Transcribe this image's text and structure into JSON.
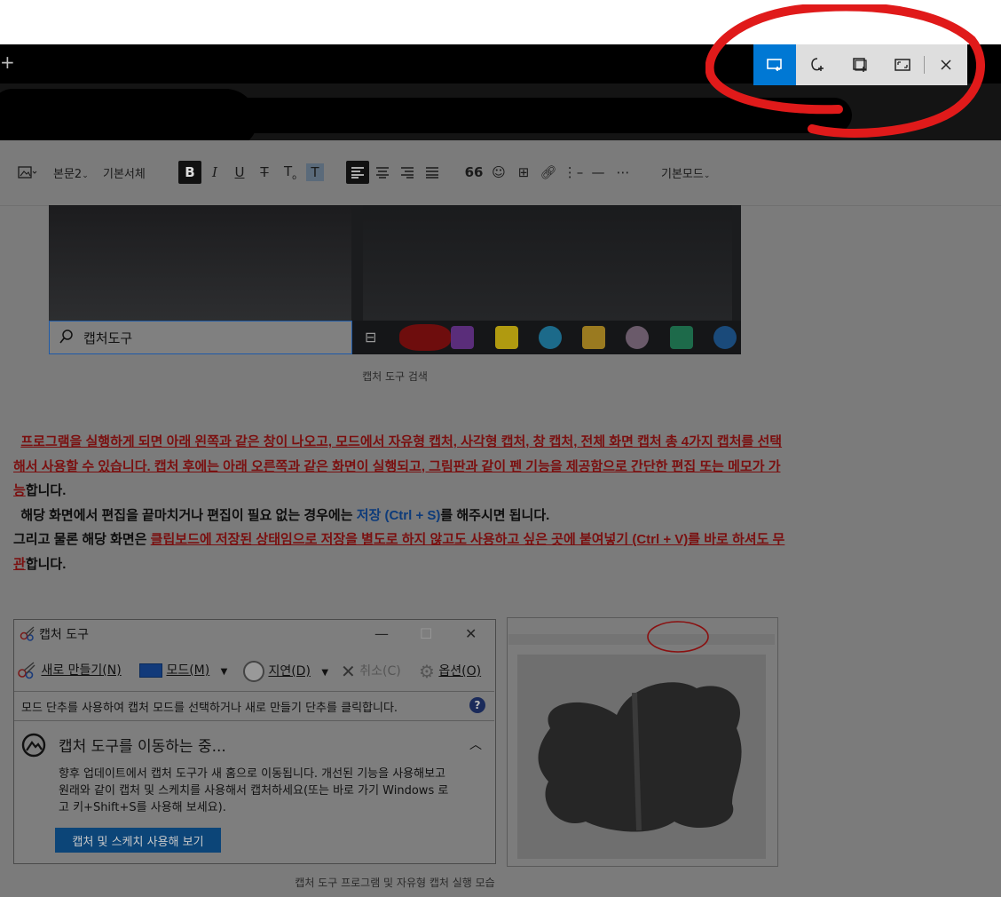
{
  "snip_toolbar": {
    "buttons": [
      {
        "name": "rectangular-snip-icon",
        "active": true
      },
      {
        "name": "freeform-snip-icon",
        "active": false
      },
      {
        "name": "window-snip-icon",
        "active": false
      },
      {
        "name": "fullscreen-snip-icon",
        "active": false
      }
    ],
    "close_icon": "close-icon",
    "accent": "#0078d4",
    "annotation_color": "#e01a1a"
  },
  "tabbar": {
    "add_label": "+"
  },
  "editor_toolbar": {
    "image_label": "",
    "paragraph_style": "본문2",
    "font": "기본서체",
    "mode": "기본모드"
  },
  "figure1": {
    "search_text": "캡처도구",
    "caption": "캡처 도구 검색"
  },
  "paragraph": {
    "line1_hl": "프로그램을 실행하게 되면 아래 왼쪽과 같은 창이 나오고, 모드에서 자유형 캡처, 사각형 캡처, 창 캡처, 전체 화면 캡처 총 4가지 캡처를 선택해서 사용할 수 있습니다. 캡처 후에는 아래 오른쪽과 같은 화면이 실행되고, 그림판과 같이 펜 기능을 제공함으로 간단한 편집 또는 메모가 가능",
    "line1_tail": "합니다.",
    "line2_pre": "해당 화면에서 편집을 끝마치거나 편집이 필요 없는 경우에는 ",
    "line2_blue": "저장 (Ctrl + S)",
    "line2_tail": "를 해주시면 됩니다.",
    "line3_pre": "그리고 물론 해당 화면은 ",
    "line3_hl": "클립보드에 저장된 상태임으로 저장을 별도로 하지 않고도 사용하고 싶은 곳에 붙여넣기 (Ctrl + V)를 바로 하셔도 무관",
    "line3_tail": "합니다."
  },
  "snipping_tool": {
    "title": "캡처 도구",
    "new_label": "새로 만들기(N)",
    "mode_label": "모드(M)",
    "delay_label": "지연(D)",
    "cancel_label": "취소(C)",
    "options_label": "옵션(O)",
    "hint": "모드 단추를 사용하여 캡처 모드를 선택하거나 새로 만들기 단추를 클릭합니다.",
    "moving_title": "캡처 도구를 이동하는 중...",
    "moving_body": "향후 업데이트에서 캡처 도구가 새 홈으로 이동됩니다. 개선된 기능을 사용해보고 원래와 같이 캡처 및 스케치를 사용해서 캡처하세요(또는 바로 가기 Windows 로고 키+Shift+S를 사용해 보세요).",
    "sketch_button": "캡처 및 스케치 사용해 보기"
  },
  "figure2": {
    "caption": "캡처 도구 프로그램 및 자유형 캡처 실행 모습"
  }
}
